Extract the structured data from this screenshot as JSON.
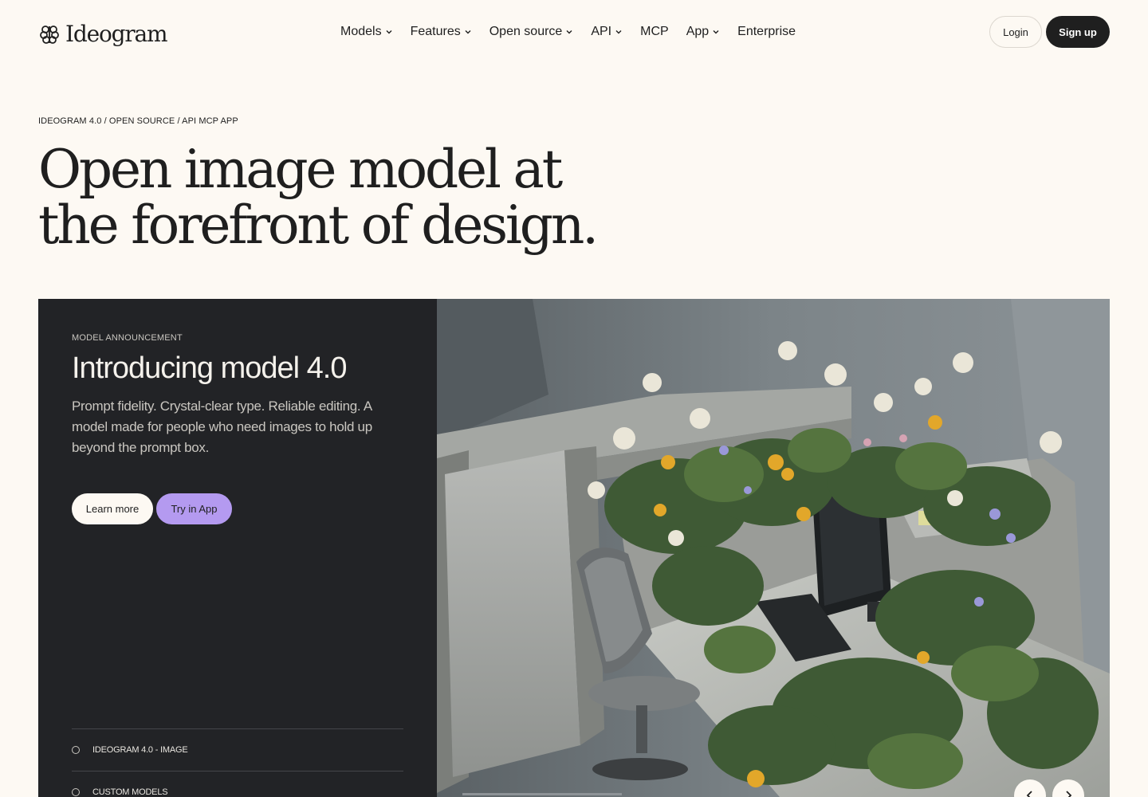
{
  "brand": {
    "name": "Ideogram"
  },
  "nav": {
    "items": [
      {
        "label": "Models",
        "has_dropdown": true
      },
      {
        "label": "Features",
        "has_dropdown": true
      },
      {
        "label": "Open source",
        "has_dropdown": true
      },
      {
        "label": "API",
        "has_dropdown": true
      },
      {
        "label": "MCP",
        "has_dropdown": false
      },
      {
        "label": "App",
        "has_dropdown": true
      },
      {
        "label": "Enterprise",
        "has_dropdown": false
      }
    ]
  },
  "auth": {
    "login_label": "Login",
    "signup_label": "Sign up"
  },
  "hero": {
    "breadcrumb": "IDEOGRAM 4.0 / OPEN SOURCE / API MCP APP",
    "headline_line1": "Open image model at",
    "headline_line2": "the forefront of design."
  },
  "card": {
    "eyebrow": "MODEL ANNOUNCEMENT",
    "title": "Introducing model 4.0",
    "description": "Prompt fidelity. Crystal-clear type. Reliable editing. A model made for people who need images to hold up beyond the prompt box.",
    "learn_more_label": "Learn more",
    "try_label": "Try in App",
    "list": [
      {
        "label": "IDEOGRAM 4.0 - IMAGE"
      },
      {
        "label": "CUSTOM MODELS"
      }
    ],
    "image_alt_icon": "office-cubicle-overgrown-with-wildflowers-image"
  },
  "colors": {
    "background": "#fdf9f3",
    "dark_panel": "#222326",
    "accent_purple": "#b49af0",
    "text_primary": "#1f1f1f"
  },
  "icons": {
    "dropdown": "chevron-down-icon",
    "prev": "chevron-left-icon",
    "next": "chevron-right-icon",
    "logo": "brain-logo-icon"
  }
}
